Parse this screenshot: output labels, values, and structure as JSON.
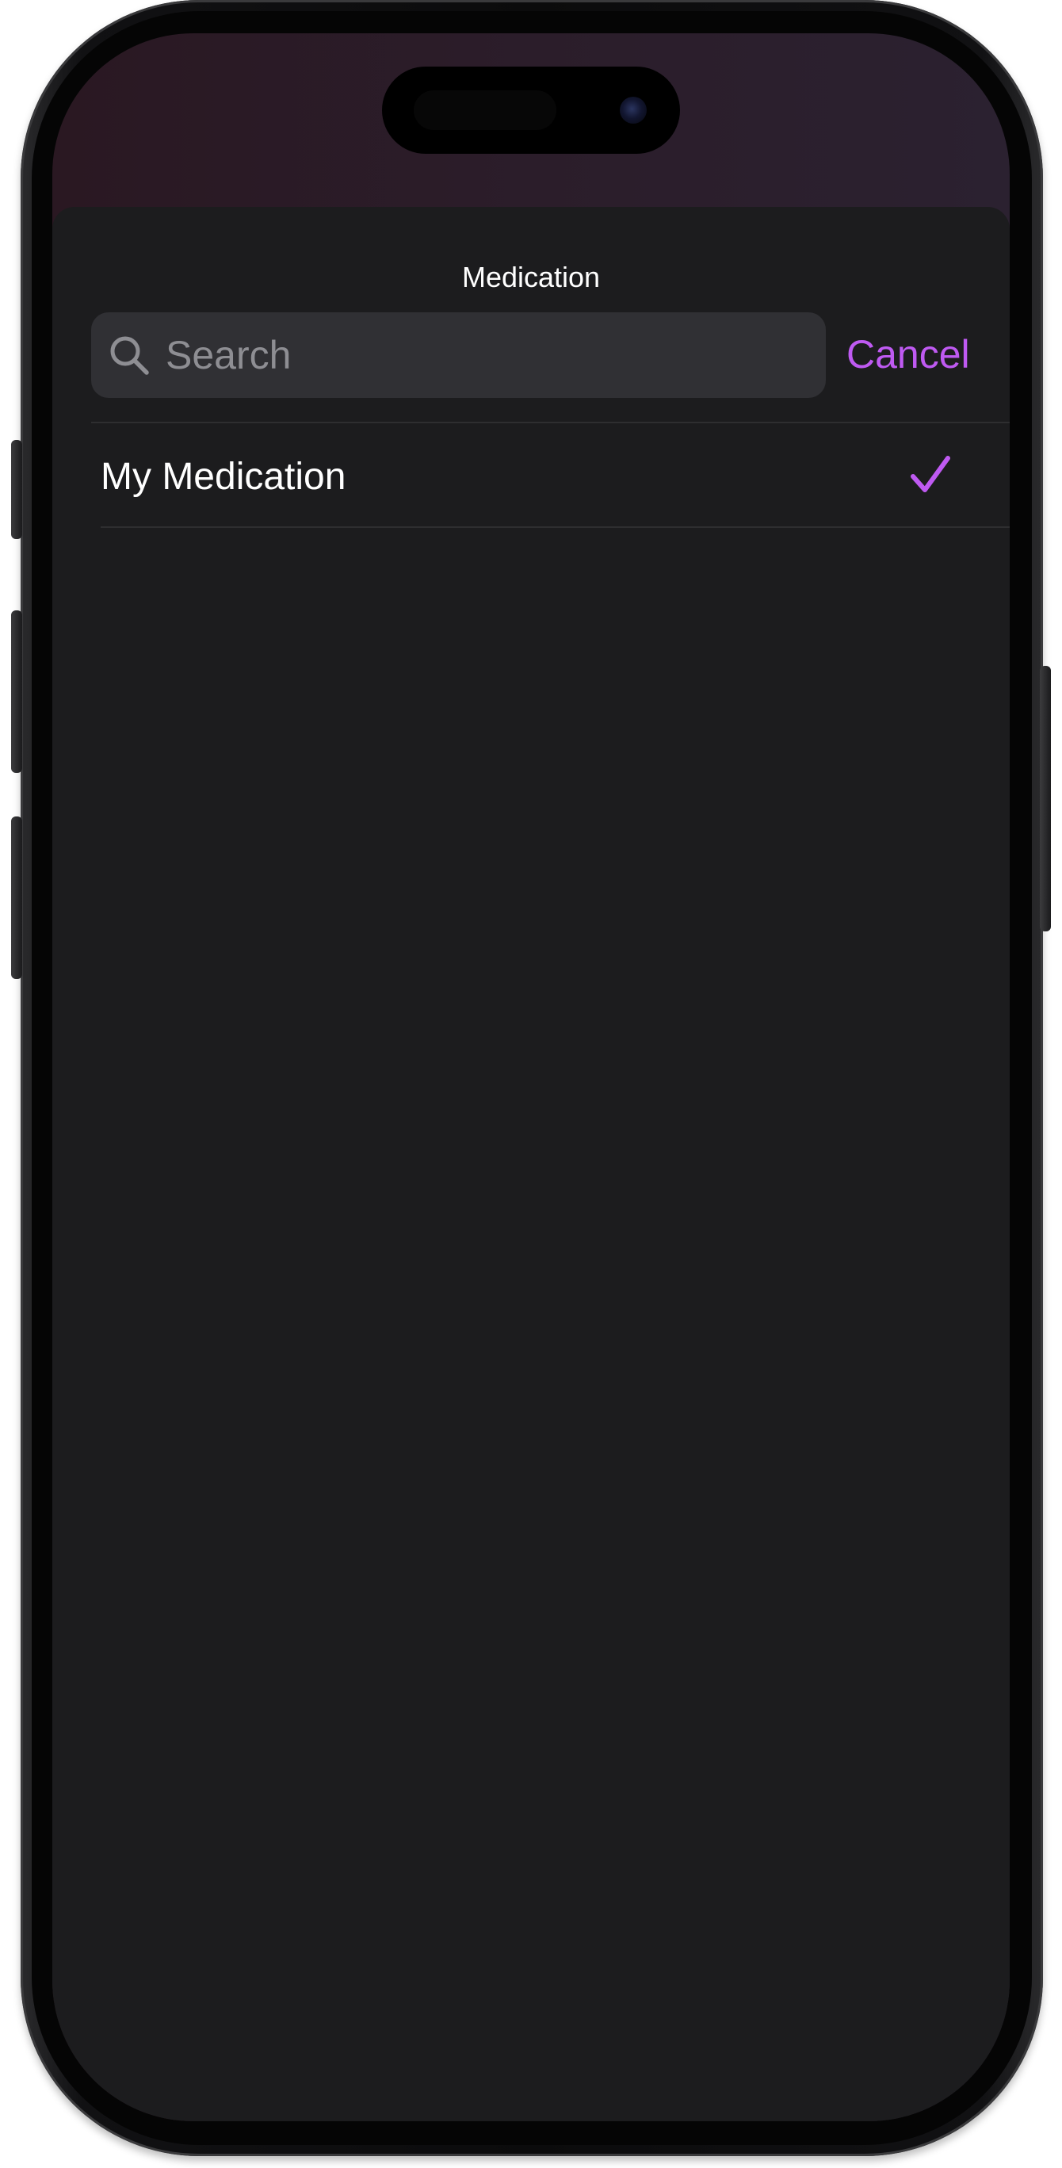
{
  "sheet": {
    "title": "Medication"
  },
  "search": {
    "placeholder": "Search",
    "cancel_label": "Cancel"
  },
  "list": {
    "items": [
      {
        "label": "My Medication",
        "selected": true
      }
    ]
  },
  "colors": {
    "accent": "#bf5af2",
    "sheet_background": "#1c1c1e",
    "search_field_background": "#303034",
    "placeholder_text": "#8e8e93"
  },
  "icons": {
    "search": "magnifying-glass",
    "selected": "checkmark"
  }
}
